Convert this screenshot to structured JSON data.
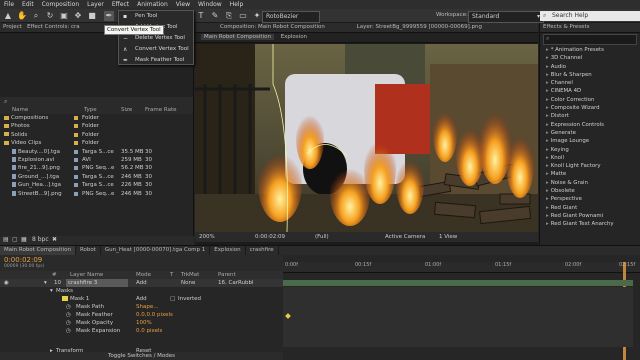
{
  "menubar": [
    "File",
    "Edit",
    "Composition",
    "Layer",
    "Effect",
    "Animation",
    "View",
    "Window",
    "Help"
  ],
  "toolbar": {
    "rotobezier_label": "RotoBezier",
    "workspace_label": "Workspace:",
    "workspace_value": "Standard",
    "search_placeholder": "Search Help"
  },
  "pen_menu": {
    "items": [
      "Pen Tool",
      "Add Vertex Tool",
      "Delete Vertex Tool",
      "Convert Vertex Tool",
      "Mask Feather Tool"
    ],
    "tooltip": "Convert Vertex Tool"
  },
  "project_panel": {
    "tabs": [
      "Project",
      "Effect Controls: cra"
    ],
    "columns": [
      "Name",
      "Type",
      "Size",
      "Frame Rate"
    ],
    "items": [
      {
        "name": "Compositions",
        "type": "Folder",
        "size": "",
        "fr": "",
        "kind": "folder",
        "depth": 0
      },
      {
        "name": "Photos",
        "type": "Folder",
        "size": "",
        "fr": "",
        "kind": "folder",
        "depth": 0
      },
      {
        "name": "Solids",
        "type": "Folder",
        "size": "",
        "fr": "",
        "kind": "folder",
        "depth": 0
      },
      {
        "name": "Video Clips",
        "type": "Folder",
        "size": "",
        "fr": "",
        "kind": "folder",
        "depth": 0
      },
      {
        "name": "Beauty....0].tga",
        "type": "Targa S...ce",
        "size": "35.5 MB",
        "fr": "30",
        "kind": "file",
        "depth": 1
      },
      {
        "name": "Explosion.avi",
        "type": "AVI",
        "size": "259 MB",
        "fr": "30",
        "kind": "file",
        "depth": 1
      },
      {
        "name": "fire_21...9].png",
        "type": "PNG Seq...e",
        "size": "56.2 MB",
        "fr": "30",
        "kind": "file",
        "depth": 1
      },
      {
        "name": "Ground_...].tga",
        "type": "Targa S...ce",
        "size": "246 MB",
        "fr": "30",
        "kind": "file",
        "depth": 1
      },
      {
        "name": "Gun_Hea...].tga",
        "type": "Targa S...ce",
        "size": "226 MB",
        "fr": "30",
        "kind": "file",
        "depth": 1
      },
      {
        "name": "StreetB...9].png",
        "type": "PNG Seq...e",
        "size": "246 MB",
        "fr": "30",
        "kind": "file",
        "depth": 1
      }
    ]
  },
  "composition_panel": {
    "tab": "Composition: Main Robot Composition",
    "layer_tab": "Layer: StreetBg_9999559 [00000-00069].png",
    "subtabs": [
      "Main Robot Composition",
      "Explosion"
    ],
    "footer": [
      "200%",
      "0:00:02:09",
      "(Full)",
      "Active Camera",
      "1 View"
    ]
  },
  "effects_panel": {
    "title": "Effects & Presets",
    "search_value": "",
    "items": [
      "* Animation Presets",
      "3D Channel",
      "Audio",
      "Blur & Sharpen",
      "Channel",
      "CINEMA 4D",
      "Color Correction",
      "Composite Wizard",
      "Distort",
      "Expression Controls",
      "Generate",
      "Image Lounge",
      "Keying",
      "Knoll",
      "Knoll Light Factory",
      "Matte",
      "Noise & Grain",
      "Obsolete",
      "Perspective",
      "Red Giant",
      "Red Giant Pownami",
      "Red Giant Text Anarchy"
    ]
  },
  "timeline": {
    "tabs": [
      "Main Robot Composition",
      "Robot",
      "Gun_Heat [0000-00070].tga Comp 1",
      "Explosion",
      "crashfire"
    ],
    "timecode": "0:00:02:09",
    "frame_info": "00069 (30.00 fps)",
    "columns": [
      "#",
      "Layer Name",
      "Mode",
      "T",
      "TrkMat",
      "Parent"
    ],
    "ruler": [
      "0:00f",
      "00:15f",
      "01:00f",
      "01:15f",
      "02:00f",
      "02:15f"
    ],
    "layer": {
      "index": "10",
      "name": "crashfire 3",
      "mode": "Add",
      "trkmat": "None",
      "parent": "16. CarRubbl"
    },
    "masks_label": "Masks",
    "mask": {
      "name": "Mask 1",
      "mode": "Add",
      "inverted": "Inverted"
    },
    "props": [
      {
        "name": "Mask Path",
        "value": "Shape..."
      },
      {
        "name": "Mask Feather",
        "value": "0.0,0.0 pixels"
      },
      {
        "name": "Mask Opacity",
        "value": "100%"
      },
      {
        "name": "Mask Expansion",
        "value": "0.0 pixels"
      }
    ],
    "transform_label": "Transform",
    "transform_value": "Reset",
    "toggle_label": "Toggle Switches / Modes"
  }
}
